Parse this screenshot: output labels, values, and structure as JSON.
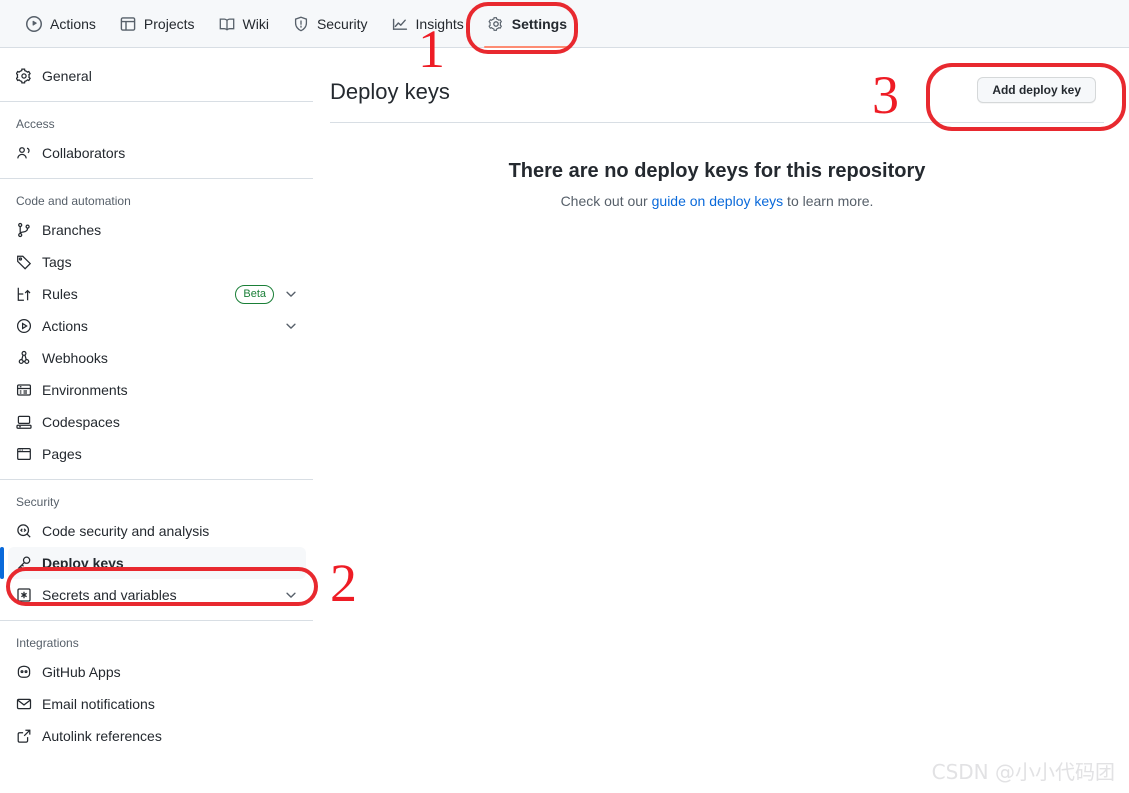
{
  "topnav": {
    "items": [
      {
        "label": "Actions",
        "icon": "play-circle-icon",
        "active": false
      },
      {
        "label": "Projects",
        "icon": "table-icon",
        "active": false
      },
      {
        "label": "Wiki",
        "icon": "book-icon",
        "active": false
      },
      {
        "label": "Security",
        "icon": "shield-icon",
        "active": false
      },
      {
        "label": "Insights",
        "icon": "graph-icon",
        "active": false
      },
      {
        "label": "Settings",
        "icon": "gear-icon",
        "active": true
      }
    ]
  },
  "sidebar": {
    "general": {
      "label": "General",
      "icon": "gear-icon"
    },
    "sections": [
      {
        "heading": "Access",
        "items": [
          {
            "label": "Collaborators",
            "icon": "people-icon"
          }
        ]
      },
      {
        "heading": "Code and automation",
        "items": [
          {
            "label": "Branches",
            "icon": "git-branch-icon"
          },
          {
            "label": "Tags",
            "icon": "tag-icon"
          },
          {
            "label": "Rules",
            "icon": "rules-icon",
            "badge": "Beta",
            "chevron": true
          },
          {
            "label": "Actions",
            "icon": "play-circle-icon",
            "chevron": true
          },
          {
            "label": "Webhooks",
            "icon": "webhook-icon"
          },
          {
            "label": "Environments",
            "icon": "server-icon"
          },
          {
            "label": "Codespaces",
            "icon": "codespaces-icon"
          },
          {
            "label": "Pages",
            "icon": "browser-icon"
          }
        ]
      },
      {
        "heading": "Security",
        "items": [
          {
            "label": "Code security and analysis",
            "icon": "codescan-icon"
          },
          {
            "label": "Deploy keys",
            "icon": "key-icon",
            "selected": true
          },
          {
            "label": "Secrets and variables",
            "icon": "asterisk-icon",
            "chevron": true
          }
        ]
      },
      {
        "heading": "Integrations",
        "items": [
          {
            "label": "GitHub Apps",
            "icon": "apps-icon"
          },
          {
            "label": "Email notifications",
            "icon": "mail-icon"
          },
          {
            "label": "Autolink references",
            "icon": "link-external-icon"
          }
        ]
      }
    ]
  },
  "main": {
    "title": "Deploy keys",
    "add_button": "Add deploy key",
    "empty_heading": "There are no deploy keys for this repository",
    "empty_text_before": "Check out our ",
    "empty_link": "guide on deploy keys",
    "empty_text_after": " to learn more."
  },
  "annotations": {
    "step1": "1",
    "step2": "2",
    "step3": "3",
    "color": "#ee1c25"
  },
  "watermark": "CSDN @小小代码团",
  "colors": {
    "accent_blue": "#0969da",
    "active_tab_underline": "#fd8c73",
    "beta_green": "#1a7f37",
    "annotation_red": "#ee1c25"
  }
}
